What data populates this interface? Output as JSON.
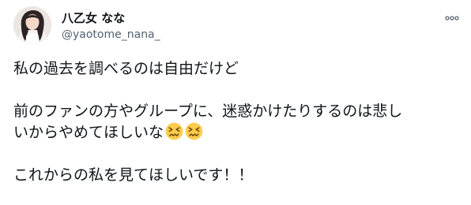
{
  "author": {
    "display_name": "八乙女 なな",
    "handle": "@yaotome_nana_"
  },
  "icons": {
    "more": "more-horizontal-icon",
    "emoji": "confounded-face-emoji"
  },
  "tweet": {
    "line1": "私の過去を調べるのは自由だけど",
    "line2": "前のファンの方やグループに、迷惑かけたりするのは悲し",
    "line3": "いからやめてほしいな",
    "line4": "これからの私を見てほしいです！！",
    "emoji_count": 2
  },
  "colors": {
    "text": "#0f1419",
    "secondary": "#536471",
    "emoji_face": "#ffcc4d"
  }
}
